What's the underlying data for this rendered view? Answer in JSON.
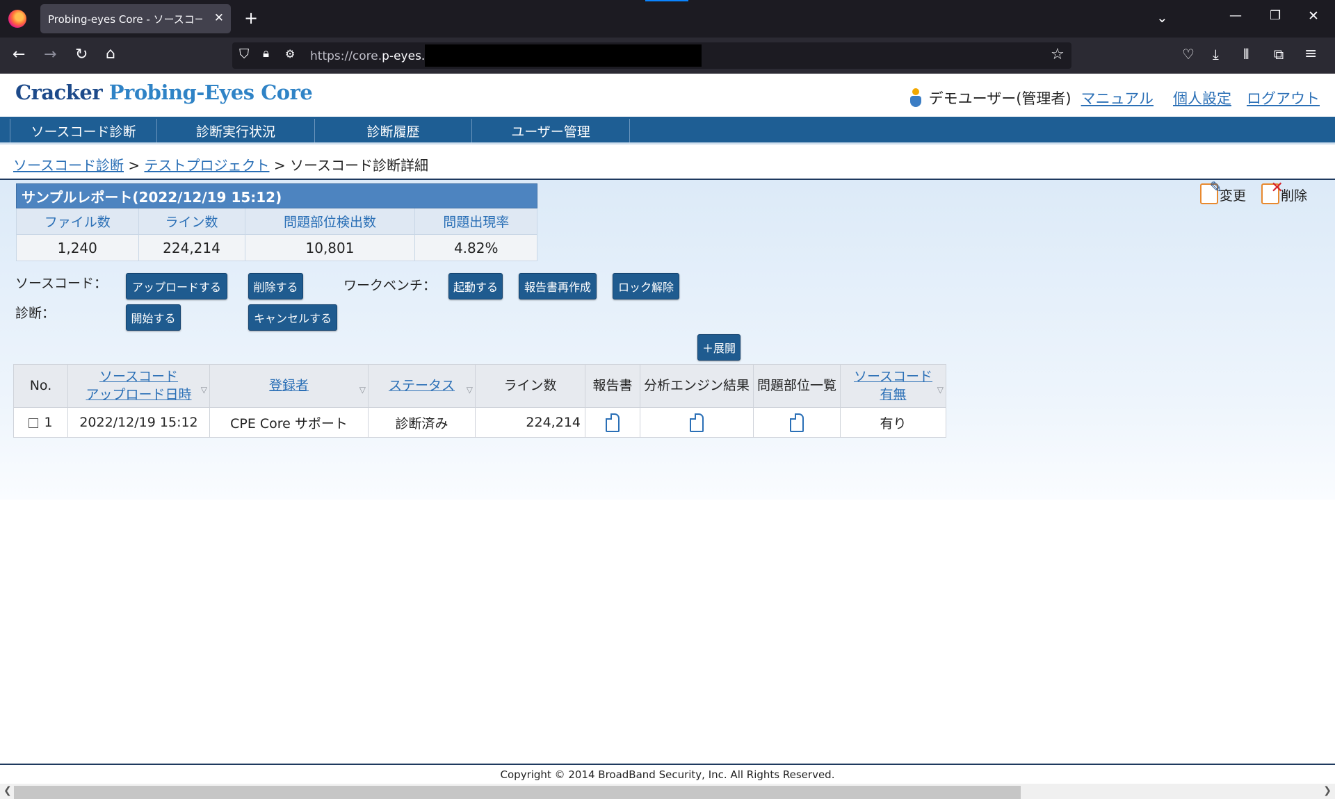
{
  "browser": {
    "tab_title": "Probing-eyes Core - ソースコード診断詳",
    "url_prefix": "https://core.",
    "url_host": "p-eyes.jp",
    "url_suffix": "/"
  },
  "header": {
    "logo_part1": "Cracker",
    "logo_part2": "Probing-Eyes Core",
    "user_name": "デモユーザー(管理者)",
    "link_manual": "マニュアル",
    "link_settings": "個人設定",
    "link_logout": "ログアウト"
  },
  "nav": [
    "ソースコード診断",
    "診断実行状況",
    "診断履歴",
    "ユーザー管理"
  ],
  "breadcrumb": {
    "crumb1": "ソースコード診断",
    "sep": " > ",
    "crumb2": "テストプロジェクト",
    "current": "ソースコード診断詳細"
  },
  "actions": {
    "edit": "変更",
    "delete": "削除"
  },
  "summary": {
    "title": "サンプルレポート(2022/12/19 15:12)",
    "headers": [
      "ファイル数",
      "ライン数",
      "問題部位検出数",
      "問題出現率"
    ],
    "values": [
      "1,240",
      "224,214",
      "10,801",
      "4.82%"
    ]
  },
  "controls": {
    "source_label": "ソースコード：",
    "diag_label": "診断：",
    "workbench_label": "ワークベンチ：",
    "upload": "アップロードする",
    "delete": "削除する",
    "start_wb": "起動する",
    "regen_report": "報告書再作成",
    "unlock": "ロック解除",
    "start_diag": "開始する",
    "cancel": "キャンセルする",
    "expand": "＋展開"
  },
  "table": {
    "h_no": "No.",
    "h_upload_1": "ソースコード",
    "h_upload_2": "アップロード日時",
    "h_registrant": "登録者",
    "h_status": "ステータス",
    "h_lines": "ライン数",
    "h_report": "報告書",
    "h_engine": "分析エンジン結果",
    "h_issues": "問題部位一覧",
    "h_src_1": "ソースコード",
    "h_src_2": "有無",
    "sort_glyph": "▽",
    "rows": [
      {
        "no": "1",
        "datetime": "2022/12/19 15:12",
        "registrant": "CPE Core サポート",
        "status": "診断済み",
        "lines": "224,214",
        "source": "有り"
      }
    ]
  },
  "footer": {
    "copyright": "Copyright © 2014 BroadBand Security, Inc. All Rights Reserved."
  },
  "icons": [
    "firefox-logo",
    "close-icon",
    "plus-icon",
    "chevron-down-icon",
    "minimize-icon",
    "restore-icon",
    "back-icon",
    "forward-icon",
    "reload-icon",
    "home-icon",
    "shield-icon",
    "lock-icon",
    "permissions-icon",
    "star-icon",
    "pocket-icon",
    "download-icon",
    "library-icon",
    "extensions-icon",
    "menu-icon",
    "user-icon",
    "edit-icon",
    "delete-icon",
    "document-icon"
  ]
}
